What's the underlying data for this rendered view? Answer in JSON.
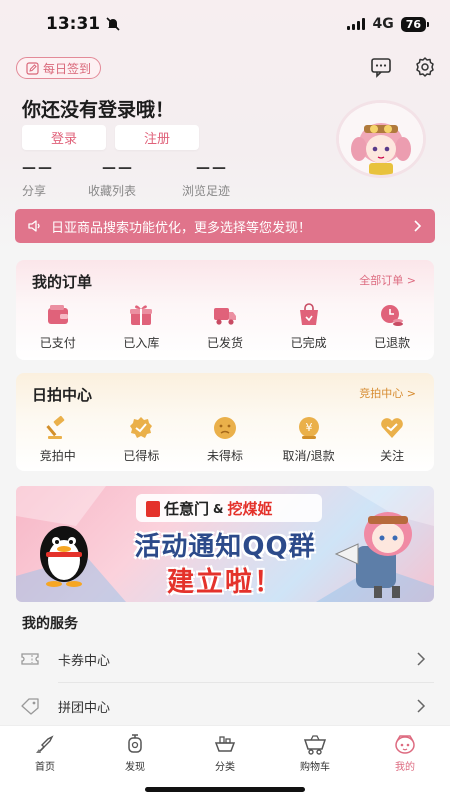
{
  "status_bar": {
    "time": "13:31",
    "network": "4G",
    "battery": "76"
  },
  "header": {
    "checkin_label": "每日签到",
    "message_icon": "message-icon",
    "settings_icon": "gear-icon"
  },
  "profile": {
    "login_prompt": "你还没有登录哦！",
    "login_button": "登录",
    "register_button": "注册",
    "stats": [
      {
        "value": "——",
        "label": "分享"
      },
      {
        "value": "——",
        "label": "收藏列表"
      },
      {
        "value": "——",
        "label": "浏览足迹"
      }
    ]
  },
  "notice": {
    "text": "日亚商品搜索功能优化，更多选择等您发现！"
  },
  "orders": {
    "title": "我的订单",
    "link": "全部订单 >",
    "items": [
      {
        "label": "已支付",
        "icon": "wallet-icon"
      },
      {
        "label": "已入库",
        "icon": "gift-box-icon"
      },
      {
        "label": "已发货",
        "icon": "truck-icon"
      },
      {
        "label": "已完成",
        "icon": "shopping-bag-icon"
      },
      {
        "label": "已退款",
        "icon": "refund-icon"
      }
    ]
  },
  "auction": {
    "title": "日拍中心",
    "link": "竞拍中心 >",
    "items": [
      {
        "label": "竞拍中",
        "icon": "gavel-icon"
      },
      {
        "label": "已得标",
        "icon": "badge-check-icon"
      },
      {
        "label": "未得标",
        "icon": "sad-face-icon"
      },
      {
        "label": "取消/退款",
        "icon": "yen-coin-icon"
      },
      {
        "label": "关注",
        "icon": "heart-check-icon"
      }
    ]
  },
  "banner": {
    "brand_left": "任意门",
    "ampersand": "&",
    "brand_right": "挖煤姬",
    "headline_1": "活动通知QQ群",
    "headline_2": "建立啦！"
  },
  "services": {
    "title": "我的服务",
    "items": [
      {
        "label": "卡券中心",
        "icon": "ticket-icon"
      },
      {
        "label": "拼团中心",
        "icon": "tag-icon"
      }
    ]
  },
  "tabbar": {
    "items": [
      {
        "label": "首页",
        "icon": "shovel-icon"
      },
      {
        "label": "发现",
        "icon": "lantern-icon"
      },
      {
        "label": "分类",
        "icon": "category-cart-icon"
      },
      {
        "label": "购物车",
        "icon": "mine-cart-icon"
      },
      {
        "label": "我的",
        "icon": "avatar-icon"
      }
    ]
  },
  "colors": {
    "accent": "#e0627a",
    "auction_accent": "#d68a2e",
    "notice_bg": "#e0748b"
  }
}
